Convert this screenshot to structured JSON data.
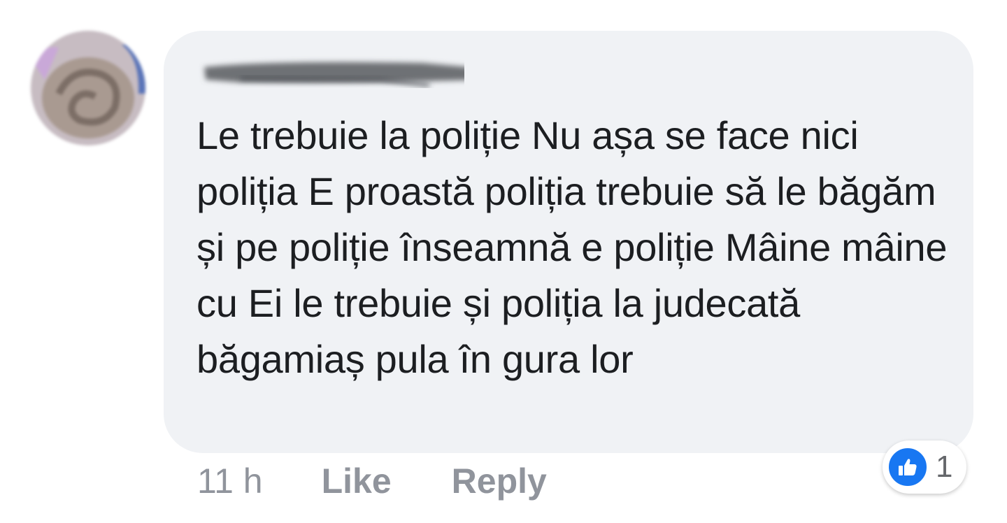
{
  "comment": {
    "text": "Le trebuie la poliție Nu așa se face nici poliția E proastă poliția trebuie să le băgăm și pe poliție înseamnă e poliție Mâine mâine cu Ei le trebuie și poliția la judecată băgamiaș pula în gura lor"
  },
  "actions": {
    "timestamp": "11 h",
    "like_label": "Like",
    "reply_label": "Reply"
  },
  "reactions": {
    "count": "1",
    "icon": "thumbs-up-icon"
  },
  "colors": {
    "bubble": "#f0f2f5",
    "text": "#1c1e21",
    "meta": "#90949c",
    "like_blue": "#1877f2"
  }
}
